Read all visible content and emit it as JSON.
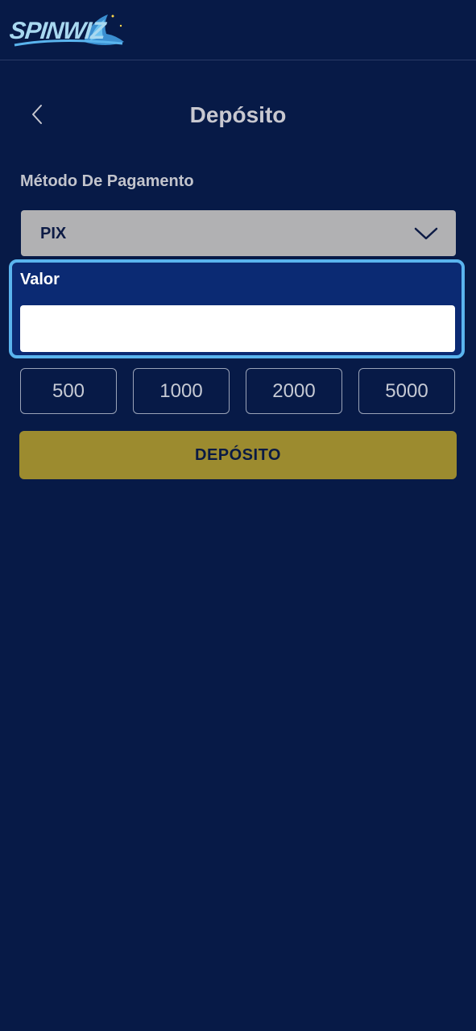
{
  "header": {
    "logo_text": "SPINWIZ"
  },
  "page": {
    "title": "Depósito",
    "back_icon": "chevron-left-icon"
  },
  "payment": {
    "label": "Método De Pagamento",
    "selected": "PIX",
    "chevron_icon": "chevron-down-icon"
  },
  "amount": {
    "label": "Valor",
    "value": "",
    "placeholder": ""
  },
  "quick_amounts": [
    "500",
    "1000",
    "2000",
    "5000"
  ],
  "deposit_button": {
    "label": "DEPÓSITO"
  },
  "colors": {
    "background": "#071a47",
    "accent_border": "#5ab4ee",
    "deposit_button": "#9c8b2f",
    "select_bg": "#b1b1b3"
  }
}
